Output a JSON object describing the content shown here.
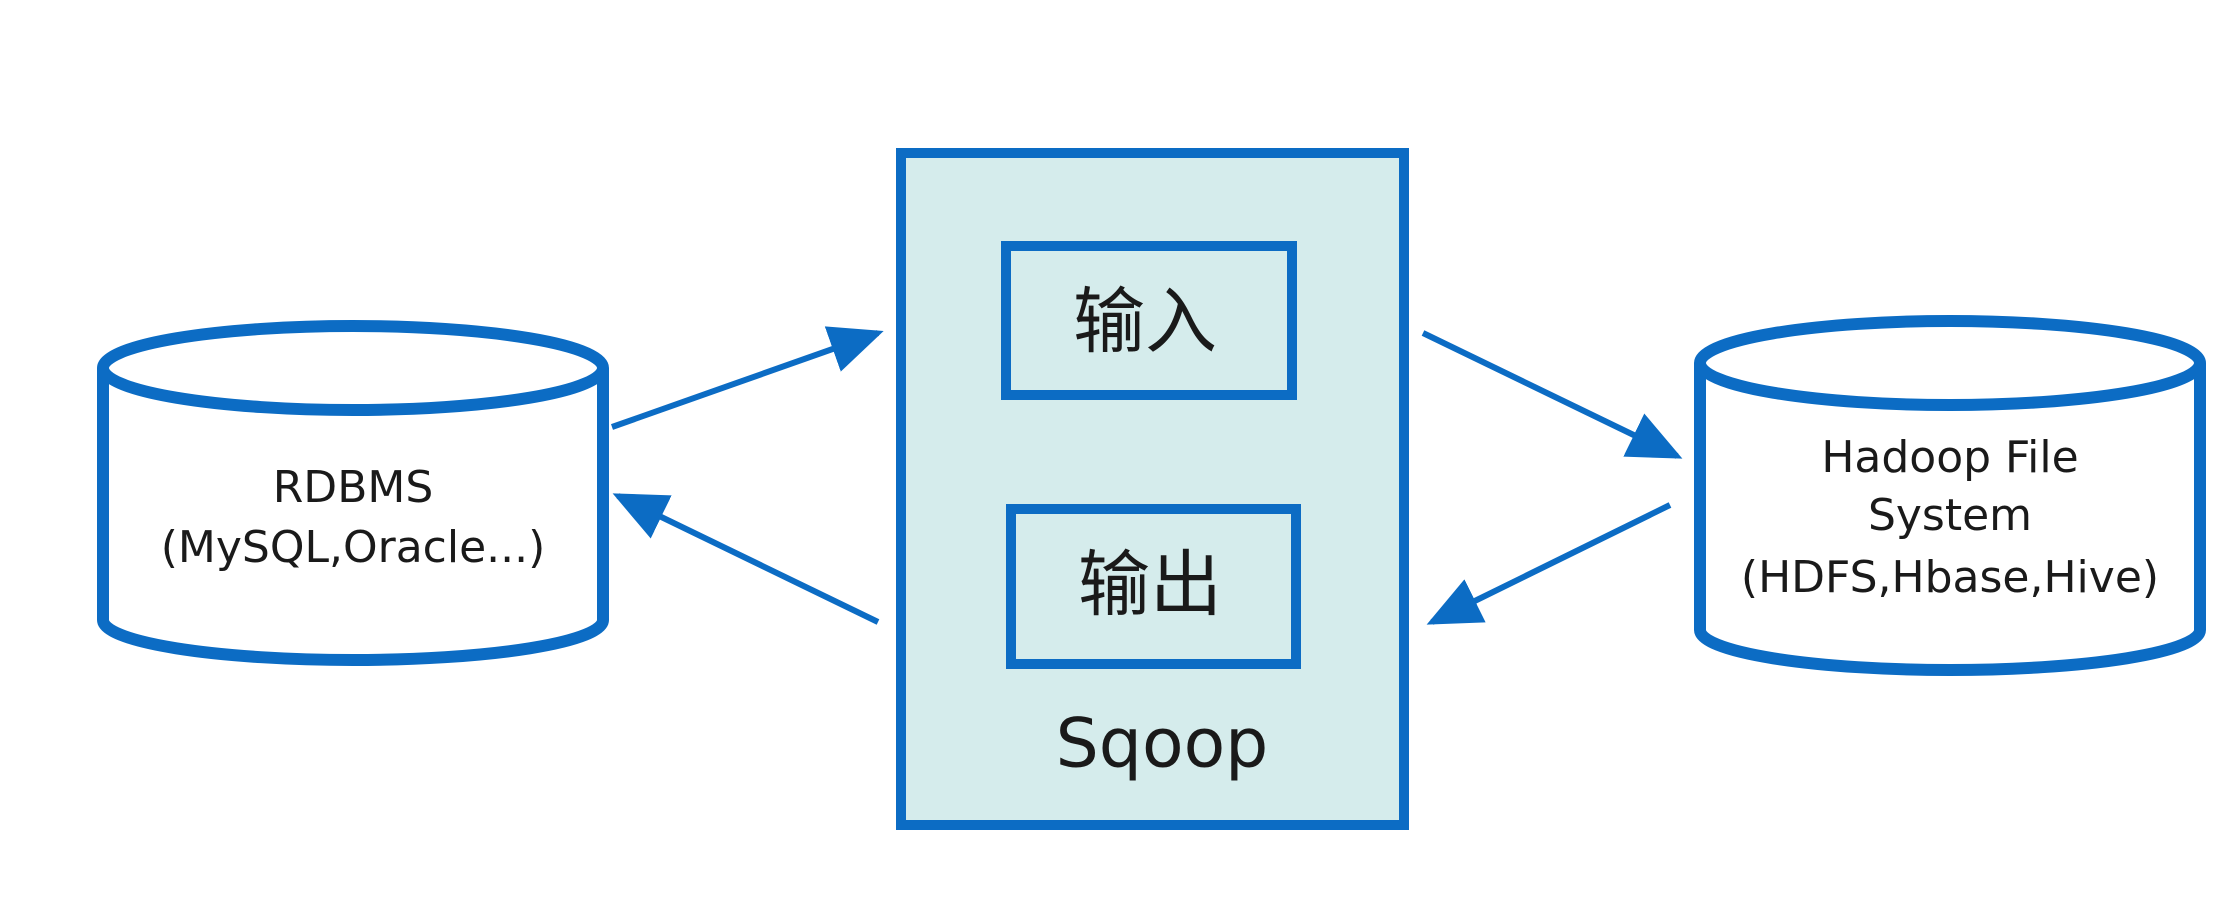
{
  "colors": {
    "stroke": "#0c6cc4",
    "sqoop_fill": "#d5ecec",
    "cylinder_fill": "#ffffff",
    "box_fill": "#d5ecec",
    "text": "#1a1a1a"
  },
  "left_db": {
    "line1": "RDBMS",
    "line2": "(MySQL,Oracle...)"
  },
  "sqoop": {
    "title": "Sqoop",
    "input_label": "输入",
    "output_label": "输出"
  },
  "right_db": {
    "line1": "Hadoop File",
    "line2": "System",
    "line3": "(HDFS,Hbase,Hive)"
  }
}
